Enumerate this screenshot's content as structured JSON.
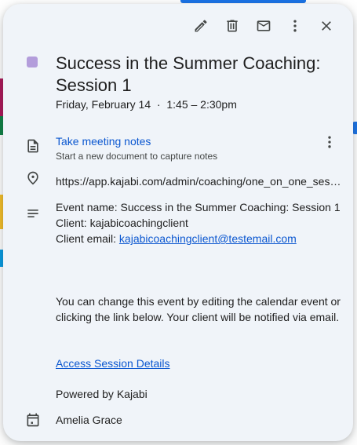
{
  "event": {
    "color": "#b39ddb",
    "title": "Success in the Summer Coaching: Session 1",
    "date": "Friday, February 14",
    "separator": "·",
    "time": "1:45 – 2:30pm"
  },
  "toolbar": {
    "edit_icon": "pencil-icon",
    "delete_icon": "trash-icon",
    "email_icon": "mail-icon",
    "more_icon": "more-vert-icon",
    "close_icon": "close-icon"
  },
  "notes": {
    "title": "Take meeting notes",
    "subtitle": "Start a new document to capture notes"
  },
  "location": "https://app.kajabi.com/admin/coaching/one_on_one_sessions",
  "description": {
    "line1": "Event name: Success in the Summer Coaching: Session 1",
    "line2": "Client: kajabicoachingclient",
    "line3_label": "Client email: ",
    "line3_email": "kajabicoachingclient@testemail.com",
    "paragraph": "You can change this event by editing the calendar event or clicking the link below. Your client will be notified via email.",
    "access_link": "Access Session Details",
    "powered_by": "Powered by Kajabi"
  },
  "calendar_owner": "Amelia Grace",
  "colors": {
    "accent": "#0b57d0",
    "popup_bg": "#f0f4f9"
  }
}
